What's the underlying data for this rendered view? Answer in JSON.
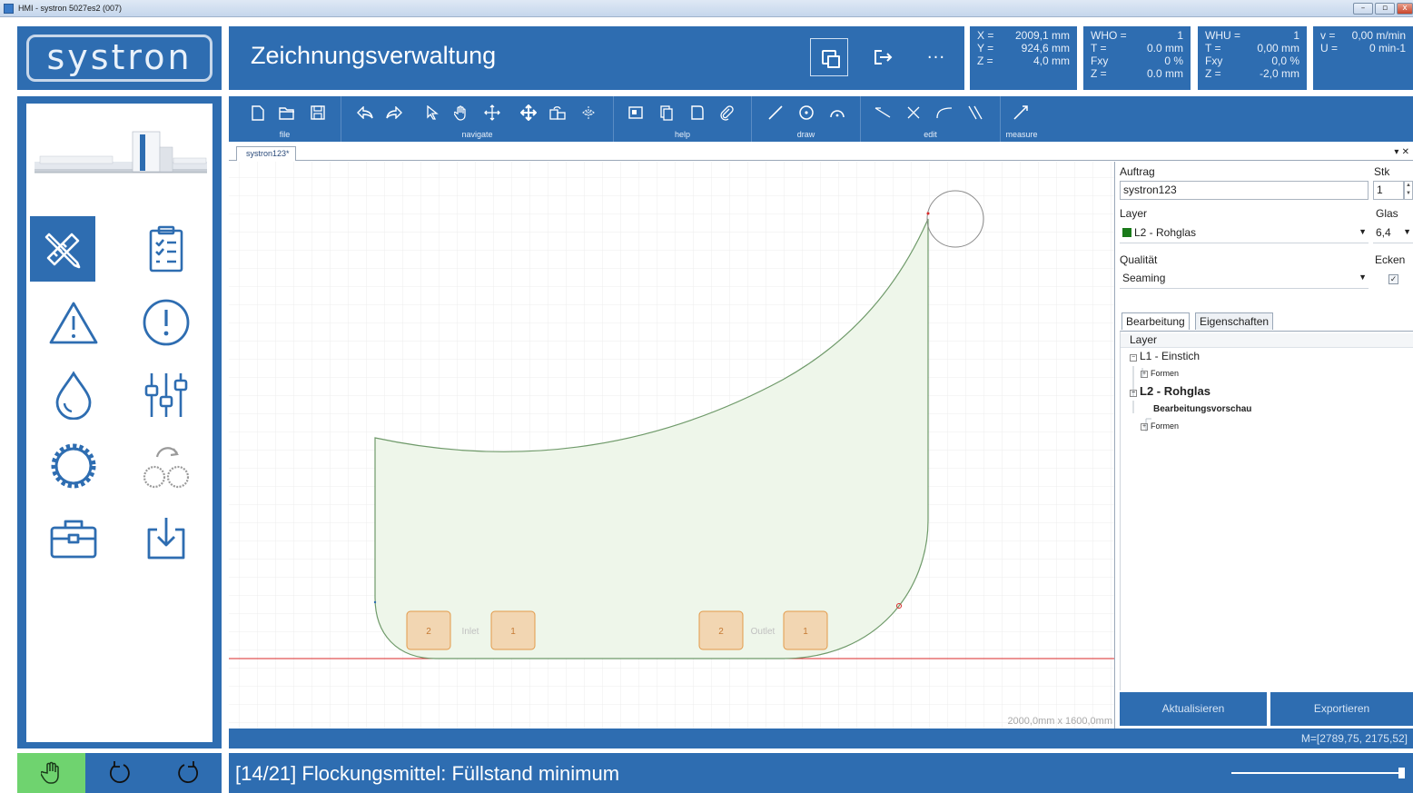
{
  "window": {
    "title": "HMI - systron 5027es2 (007)"
  },
  "header": {
    "logo": "systron",
    "title": "Zeichnungsverwaltung",
    "more": "···"
  },
  "coords": {
    "xyz": [
      {
        "label": "X =",
        "value": "2009,1 mm"
      },
      {
        "label": "Y =",
        "value": "924,6 mm"
      },
      {
        "label": "Z =",
        "value": "4,0 mm"
      }
    ],
    "who": [
      {
        "label": "WHO =",
        "value": "1"
      },
      {
        "label": "T =",
        "value": "0.0 mm"
      },
      {
        "label": "Fxy",
        "value": "0 %"
      },
      {
        "label": "Z =",
        "value": "0.0 mm"
      }
    ],
    "whu": [
      {
        "label": "WHU =",
        "value": "1"
      },
      {
        "label": "T =",
        "value": "0,00 mm"
      },
      {
        "label": "Fxy",
        "value": "0,0 %"
      },
      {
        "label": "Z =",
        "value": "-2,0 mm"
      }
    ],
    "vu": [
      {
        "label": "v =",
        "value": "0,00 m/min"
      },
      {
        "label": "U =",
        "value": "0 min-1"
      }
    ]
  },
  "toolbar": {
    "groups": [
      "file",
      "navigate",
      "help",
      "draw",
      "edit",
      "measure"
    ]
  },
  "document": {
    "tab": "systron123*",
    "dimensions": "2000,0mm x 1600,0mm"
  },
  "drawing": {
    "inlet": {
      "label": "Inlet",
      "left": "2",
      "right": "1"
    },
    "outlet": {
      "label": "Outlet",
      "left": "2",
      "right": "1"
    },
    "colors": {
      "shape_fill": "#eef6ea",
      "shape_stroke": "#6f9a6a",
      "baseline": "#d92a2a",
      "station": "#f4c494"
    }
  },
  "panel": {
    "auftrag_label": "Auftrag",
    "auftrag_value": "systron123",
    "stk_label": "Stk",
    "stk_value": "1",
    "layer_label": "Layer",
    "layer_value": "L2 - Rohglas",
    "glas_label": "Glas",
    "glas_value": "6,4",
    "qualitaet_label": "Qualität",
    "qualitaet_value": "Seaming",
    "ecken_label": "Ecken",
    "ecken_checked": "✓",
    "tabs": [
      "Bearbeitung",
      "Eigenschaften"
    ],
    "tree_header": "Layer",
    "tree": {
      "l1": "L1 - Einstich",
      "l1_formen": "Formen",
      "l2": "L2 - Rohglas",
      "l2_preview": "Bearbeitungsvorschau",
      "l2_formen": "Formen"
    },
    "btn_update": "Aktualisieren",
    "btn_export": "Exportieren"
  },
  "status": {
    "m_coord": "M=[2789,75, 2175,52]",
    "message": "[14/21] Flockungsmittel: Füllstand minimum"
  },
  "accent": "#2e6db1"
}
